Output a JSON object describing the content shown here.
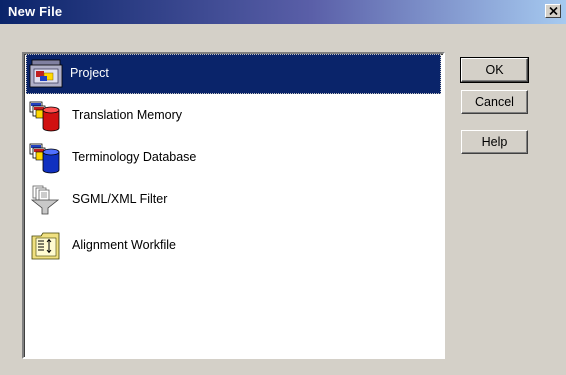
{
  "window": {
    "title": "New File",
    "close_label": "Close"
  },
  "list": {
    "items": [
      {
        "label": "Project",
        "icon": "project-icon",
        "selected": true
      },
      {
        "label": "Translation Memory",
        "icon": "translation-memory-icon",
        "selected": false
      },
      {
        "label": "Terminology Database",
        "icon": "terminology-database-icon",
        "selected": false
      },
      {
        "label": "SGML/XML Filter",
        "icon": "sgml-xml-filter-icon",
        "selected": false
      },
      {
        "label": "Alignment Workfile",
        "icon": "alignment-workfile-icon",
        "selected": false
      }
    ]
  },
  "buttons": {
    "ok": "OK",
    "cancel": "Cancel",
    "help": "Help"
  },
  "colors": {
    "titlebar_start": "#0a246a",
    "selection": "#0a246a",
    "dialog_face": "#d4d0c8"
  }
}
